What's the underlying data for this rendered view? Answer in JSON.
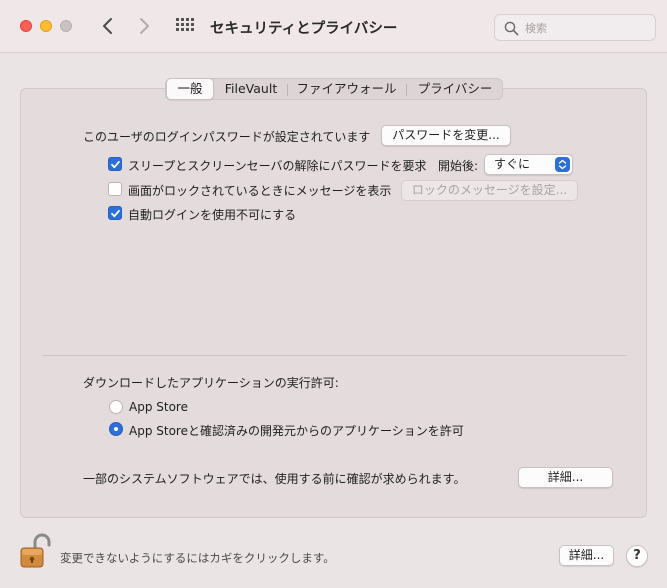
{
  "window": {
    "title": "セキュリティとプライバシー",
    "search_placeholder": "検索"
  },
  "tabs": [
    {
      "label": "一般",
      "active": true
    },
    {
      "label": "FileVault",
      "active": false
    },
    {
      "label": "ファイアウォール",
      "active": false
    },
    {
      "label": "プライバシー",
      "active": false
    }
  ],
  "general": {
    "password_set_text": "このユーザのログインパスワードが設定されています",
    "change_password_button": "パスワードを変更...",
    "require_password": {
      "label": "スリープとスクリーンセーバの解除にパスワードを要求",
      "checked": true
    },
    "delay_label": "開始後:",
    "delay_value": "すぐに",
    "show_message": {
      "label": "画面がロックされているときにメッセージを表示",
      "checked": false
    },
    "set_lock_message_button": "ロックのメッセージを設定...",
    "disable_auto_login": {
      "label": "自動ログインを使用不可にする",
      "checked": true
    }
  },
  "downloads": {
    "heading": "ダウンロードしたアプリケーションの実行許可:",
    "options": [
      {
        "label": "App Store",
        "selected": false
      },
      {
        "label": "App Storeと確認済みの開発元からのアプリケーションを許可",
        "selected": true
      }
    ],
    "system_software_text": "一部のシステムソフトウェアでは、使用する前に確認が求められます。",
    "details_button": "詳細..."
  },
  "footer": {
    "lock_text": "変更できないようにするにはカギをクリックします。",
    "advanced_button": "詳細...",
    "help_label": "?"
  },
  "colors": {
    "accent": "#2d6fd8",
    "close": "#ff5f57",
    "minimize": "#febc2e",
    "zoom_disabled": "#c8c2c3"
  }
}
